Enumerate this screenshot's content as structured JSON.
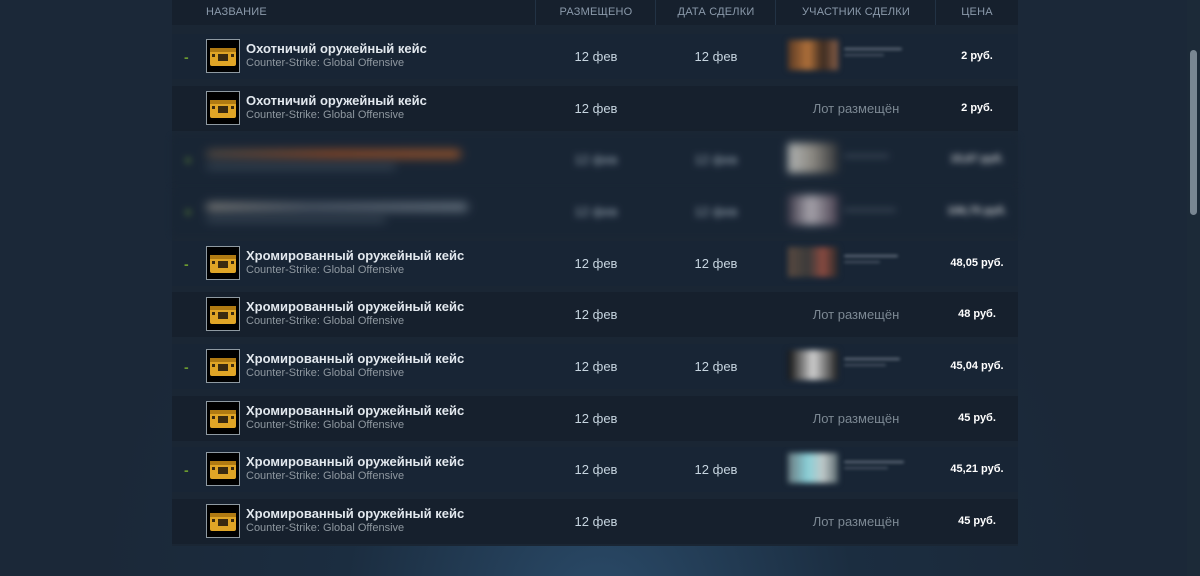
{
  "header": {
    "col_name": "НАЗВАНИЕ",
    "col_listed": "РАЗМЕЩЕНО",
    "col_acted": "ДАТА СДЕЛКИ",
    "col_actor": "УЧАСТНИК СДЕЛКИ",
    "col_price": "ЦЕНА"
  },
  "colors": {
    "background": "#1b2838",
    "row_buy": "#182535",
    "row_list": "#16202d",
    "sign_minus": "#6b9a30",
    "case_gold": "#e0a526"
  },
  "rows": [
    {
      "sign": "-",
      "icon": "weapon-case-icon",
      "name": "Охотничий оружейный кейс",
      "game": "Counter-Strike: Global Offensive",
      "listed": "12 фев",
      "acted": "12 фев",
      "actor": "",
      "price": "2 руб."
    },
    {
      "sign": "",
      "icon": "weapon-case-icon",
      "name": "Охотничий оружейный кейс",
      "game": "Counter-Strike: Global Offensive",
      "listed": "12 фев",
      "acted": "",
      "actor": "Лот размещён",
      "price": "2 руб."
    },
    {
      "sign": "+",
      "icon": "",
      "name": "",
      "game": "",
      "listed": "12 фев",
      "acted": "12 фев",
      "actor": "",
      "price": "15,67 руб."
    },
    {
      "sign": "+",
      "icon": "",
      "name": "",
      "game": "",
      "listed": "12 фев",
      "acted": "12 фев",
      "actor": "",
      "price": "106,75 руб."
    },
    {
      "sign": "-",
      "icon": "weapon-case-icon",
      "name": "Хромированный оружейный кейс",
      "game": "Counter-Strike: Global Offensive",
      "listed": "12 фев",
      "acted": "12 фев",
      "actor": "",
      "price": "48,05 руб."
    },
    {
      "sign": "",
      "icon": "weapon-case-icon",
      "name": "Хромированный оружейный кейс",
      "game": "Counter-Strike: Global Offensive",
      "listed": "12 фев",
      "acted": "",
      "actor": "Лот размещён",
      "price": "48 руб."
    },
    {
      "sign": "-",
      "icon": "weapon-case-icon",
      "name": "Хромированный оружейный кейс",
      "game": "Counter-Strike: Global Offensive",
      "listed": "12 фев",
      "acted": "12 фев",
      "actor": "",
      "price": "45,04 руб."
    },
    {
      "sign": "",
      "icon": "weapon-case-icon",
      "name": "Хромированный оружейный кейс",
      "game": "Counter-Strike: Global Offensive",
      "listed": "12 фев",
      "acted": "",
      "actor": "Лот размещён",
      "price": "45 руб."
    },
    {
      "sign": "-",
      "icon": "weapon-case-icon",
      "name": "Хромированный оружейный кейс",
      "game": "Counter-Strike: Global Offensive",
      "listed": "12 фев",
      "acted": "12 фев",
      "actor": "",
      "price": "45,21 руб."
    },
    {
      "sign": "",
      "icon": "weapon-case-icon",
      "name": "Хромированный оружейный кейс",
      "game": "Counter-Strike: Global Offensive",
      "listed": "12 фев",
      "acted": "",
      "actor": "Лот размещён",
      "price": "45 руб."
    }
  ]
}
